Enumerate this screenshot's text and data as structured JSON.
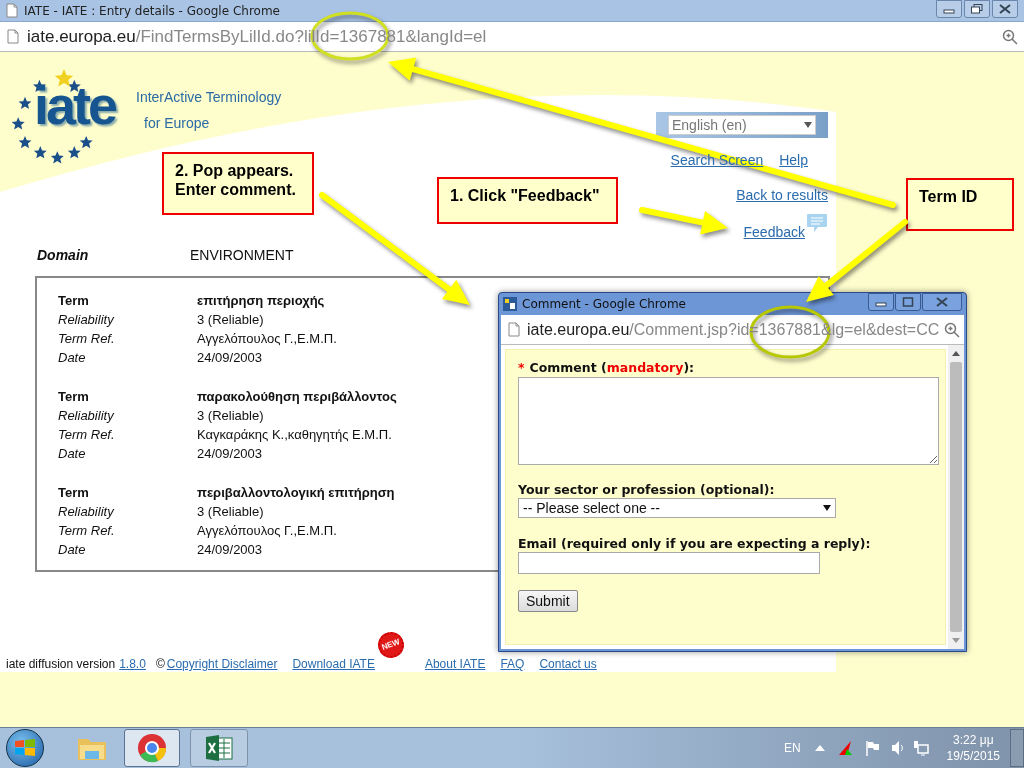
{
  "window": {
    "title": "IATE - IATE : Entry details - Google Chrome"
  },
  "address_bar": {
    "host": "iate.europa.eu",
    "path": "/FindTermsByLilId.do?lilId=1367881&langId=el"
  },
  "header": {
    "logo_text": "iate",
    "tagline": [
      "InterActive Terminology",
      "for Europe"
    ],
    "language": "English (en)",
    "links": [
      {
        "label": "Search Screen"
      },
      {
        "label": "Help"
      }
    ],
    "back_link": "Back to results",
    "feedback_link": "Feedback"
  },
  "domain": {
    "label": "Domain",
    "value": "ENVIRONMENT"
  },
  "entries": [
    {
      "fields": [
        {
          "kind": "term",
          "label": "Term",
          "value": "επιτήρηση περιοχής"
        },
        {
          "kind": "detail",
          "label": "Reliability",
          "value": "3 (Reliable)"
        },
        {
          "kind": "detail",
          "label": "Term Ref.",
          "value": "Αγγελόπουλος Γ.,Ε.Μ.Π."
        },
        {
          "kind": "detail",
          "label": "Date",
          "value": "24/09/2003"
        }
      ]
    },
    {
      "fields": [
        {
          "kind": "term",
          "label": "Term",
          "value": "παρακολούθηση περιβάλλοντος"
        },
        {
          "kind": "detail",
          "label": "Reliability",
          "value": "3 (Reliable)"
        },
        {
          "kind": "detail",
          "label": "Term Ref.",
          "value": "Καγκαράκης Κ.,καθηγητής Ε.Μ.Π."
        },
        {
          "kind": "detail",
          "label": "Date",
          "value": "24/09/2003"
        }
      ]
    },
    {
      "fields": [
        {
          "kind": "term",
          "label": "Term",
          "value": "περιβαλλοντολογική επιτήρηση"
        },
        {
          "kind": "detail",
          "label": "Reliability",
          "value": "3 (Reliable)"
        },
        {
          "kind": "detail",
          "label": "Term Ref.",
          "value": "Αγγελόπουλος Γ.,Ε.Μ.Π."
        },
        {
          "kind": "detail",
          "label": "Date",
          "value": "24/09/2003"
        }
      ]
    }
  ],
  "footer": {
    "version_label": "iate diffusion version",
    "version": "1.8.0",
    "copyright_mark": "©",
    "links": [
      {
        "label": "Copyright Disclaimer"
      },
      {
        "label": "Download IATE",
        "badge": "NEW"
      },
      {
        "label": "About IATE"
      },
      {
        "label": "FAQ"
      },
      {
        "label": "Contact us"
      }
    ]
  },
  "popup": {
    "title": "Comment - Google Chrome",
    "host": "iate.europa.eu",
    "path": "/Comment.jsp?id=1367881&lg=el&dest=CC",
    "required_mark": "*",
    "comment_label": {
      "before": "Comment (",
      "emphasis": "mandatory",
      "after": "):"
    },
    "sector_label": "Your sector or profession (optional):",
    "sector_select": "-- Please select one --",
    "email_label": "Email (required only if you are expecting a reply):",
    "submit": "Submit"
  },
  "annotations": [
    {
      "lines": [
        "2. Pop appears.",
        "Enter comment."
      ]
    },
    {
      "lines": [
        "1. Click \"Feedback\""
      ]
    },
    {
      "lines": [
        "Term ID"
      ]
    }
  ],
  "taskbar": {
    "apps": [
      {
        "kind": "folder",
        "selected": false
      },
      {
        "kind": "chrome",
        "selected": true
      },
      {
        "kind": "excel",
        "selected": false
      }
    ],
    "language": "EN",
    "time": "3:22 μμ",
    "date": "19/5/2015"
  }
}
